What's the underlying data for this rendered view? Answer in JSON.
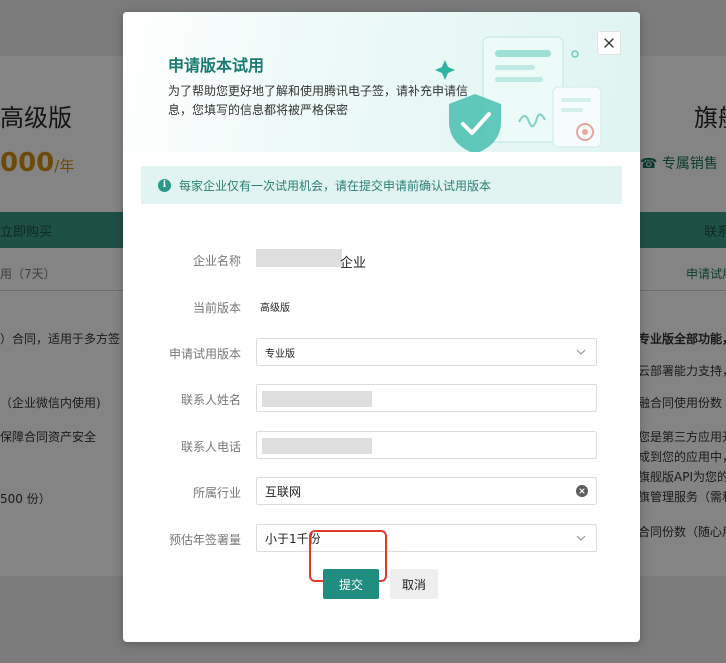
{
  "background": {
    "left_card": {
      "title": "高级版",
      "price": "000",
      "price_unit": "/年",
      "buy_button": "立即购买",
      "trial_text": "用（7天）",
      "features": [
        "）合同，适用于多方签",
        "（企业微信内使用)",
        "保障合同资产安全",
        "500 份）"
      ]
    },
    "right_card": {
      "title": "旗舰",
      "sales_text": "专属销售",
      "contact_button": "联系",
      "trial_link": "申请试用",
      "features": [
        "专业版全部功能，",
        "云部署能力支持，",
        "融合同使用份数",
        "您是第三方应用开",
        "成到您的应用中，",
        "旗舰版API为您的",
        "旗管理服务（需和",
        "合同份数（随心用"
      ]
    }
  },
  "modal": {
    "title": "申请版本试用",
    "description": "为了帮助您更好地了解和使用腾讯电子签，请补充申请信息，您填写的信息都将被严格保密",
    "notice": "每家企业仅有一次试用机会，请在提交申请前确认试用版本",
    "form": {
      "company": {
        "label": "企业名称",
        "value_suffix": "企业"
      },
      "current_version": {
        "label": "当前版本",
        "value": "高级版"
      },
      "trial_version": {
        "label": "申请试用版本",
        "value": "专业版"
      },
      "contact_name": {
        "label": "联系人姓名",
        "value": ""
      },
      "contact_phone": {
        "label": "联系人电话",
        "value": ""
      },
      "industry": {
        "label": "所属行业",
        "value": "互联网"
      },
      "annual_volume": {
        "label": "预估年签署量",
        "value": "小于1千份"
      }
    },
    "buttons": {
      "submit": "提交",
      "cancel": "取消"
    }
  },
  "colors": {
    "accent": "#1f8d7f",
    "title_green": "#1b7a70",
    "notice_bg": "#e1f4f1",
    "highlight_red": "#e23a2a",
    "overlay": "#7b7b7b"
  }
}
